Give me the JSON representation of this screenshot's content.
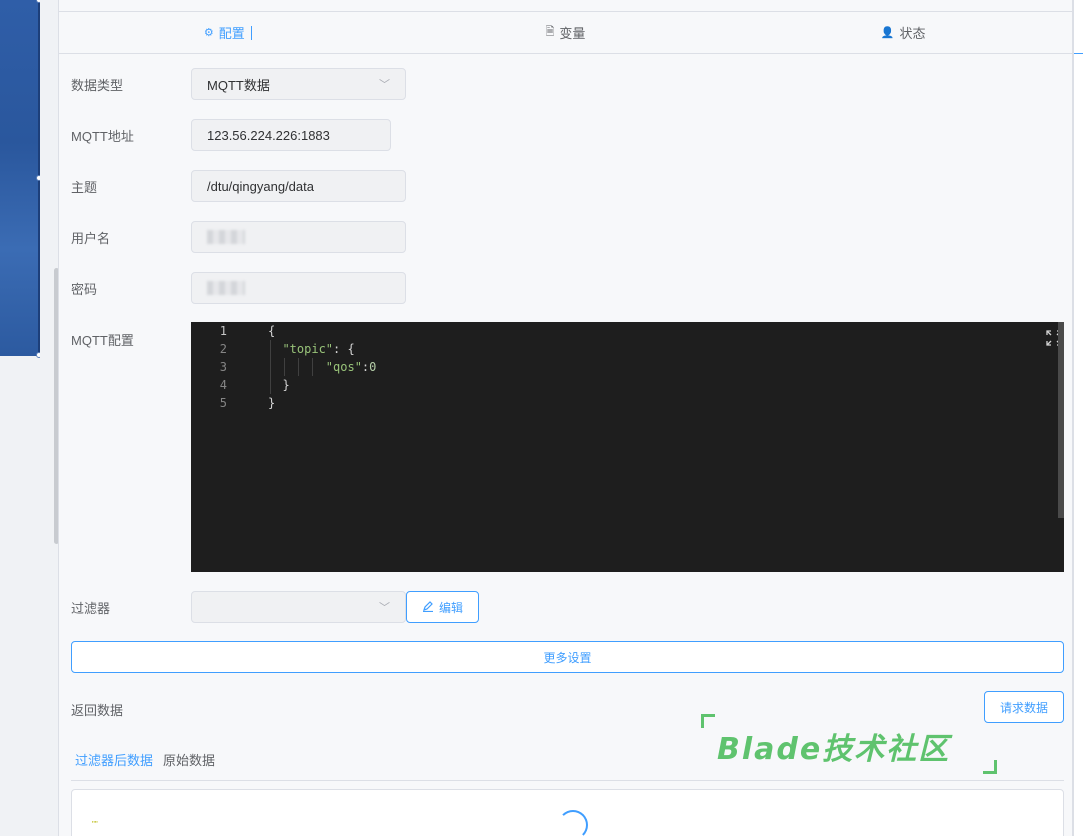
{
  "tabs": [
    {
      "label": "配置",
      "icon": "gear-icon",
      "active": true
    },
    {
      "label": "变量",
      "icon": "document-icon",
      "active": false
    },
    {
      "label": "状态",
      "icon": "user-icon",
      "active": false
    }
  ],
  "form": {
    "data_type": {
      "label": "数据类型",
      "value": "MQTT数据"
    },
    "mqtt_address": {
      "label": "MQTT地址",
      "value": "123.56.224.226:1883"
    },
    "topic": {
      "label": "主题",
      "value": "/dtu/qingyang/data"
    },
    "username": {
      "label": "用户名"
    },
    "password": {
      "label": "密码"
    },
    "mqtt_config": {
      "label": "MQTT配置"
    },
    "filter": {
      "label": "过滤器",
      "value": ""
    }
  },
  "editor": {
    "line_numbers": [
      "1",
      "2",
      "3",
      "4",
      "5"
    ],
    "lines": {
      "l1": "{",
      "l2_key": "\"topic\"",
      "l2_rest": ": {",
      "l3_key": "\"qos\"",
      "l3_colon": ":",
      "l3_val": "0",
      "l4": "}",
      "l5": "}"
    }
  },
  "buttons": {
    "edit": "编辑",
    "more_settings": "更多设置",
    "request_data": "请求数据"
  },
  "return_data": {
    "label": "返回数据",
    "tabs": [
      "过滤器后数据",
      "原始数据"
    ],
    "content": "\"\""
  },
  "watermark": {
    "text": "Blade技术社区"
  },
  "colors": {
    "accent": "#409eff",
    "editor_bg": "#1e1e1e",
    "watermark": "#5fc36e"
  }
}
